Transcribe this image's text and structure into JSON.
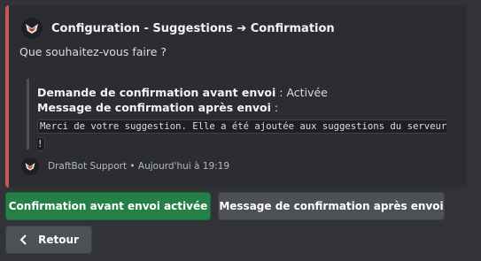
{
  "colors": {
    "background": "#313338",
    "embed_background": "#2b2d31",
    "embed_accent": "#c15a50",
    "success_button": "#248046",
    "secondary_button": "#4e5058"
  },
  "embed": {
    "author": {
      "icon": "draftbot-logo-icon",
      "title": "Configuration - Suggestions ➔ Confirmation"
    },
    "description": "Que souhaitez-vous faire ?",
    "quote": {
      "line1": {
        "label": "Demande de confirmation avant envoi",
        "sep": " : ",
        "value": "Activée"
      },
      "line2": {
        "label": "Message de confirmation après envoi",
        "sep": " :"
      },
      "code": "Merci de votre suggestion. Elle a été ajoutée aux suggestions du serveur !"
    },
    "footer": {
      "icon": "draftbot-logo-icon",
      "text": "DraftBot Support • Aujourd'hui à 19:19"
    }
  },
  "buttons": {
    "confirm_before_send": "Confirmation avant envoi activée",
    "confirm_after_send": "Message de confirmation après envoi",
    "back": "Retour",
    "back_icon": "chevron-left-icon"
  }
}
